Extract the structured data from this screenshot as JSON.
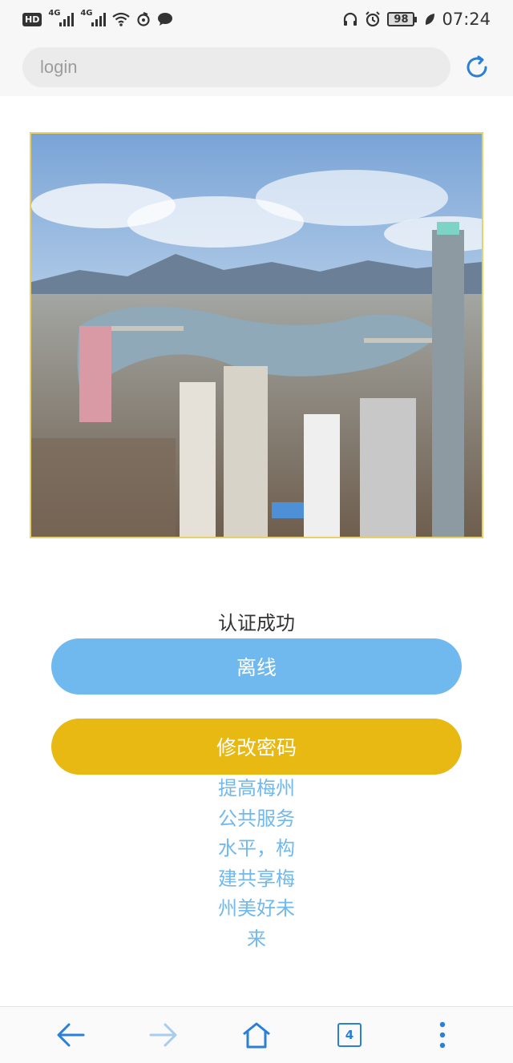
{
  "status_bar": {
    "hd_label": "HD",
    "signal1_label": "4G",
    "signal2_label": "4G",
    "battery": "98",
    "time": "07:24"
  },
  "address_bar": {
    "placeholder": "login"
  },
  "main": {
    "status_text": "认证成功",
    "offline_button": "离线",
    "change_password_button": "修改密码",
    "slogan": "提高梅州公共服务水平，构建共享梅州美好未来"
  },
  "bottom_nav": {
    "tab_count": "4"
  },
  "colors": {
    "accent_blue": "#6fb9ee",
    "accent_yellow": "#e8b912",
    "nav_blue": "#2a7fd6"
  },
  "icons": [
    "back-arrow-icon",
    "forward-arrow-icon",
    "home-icon",
    "tabs-icon",
    "more-vertical-icon",
    "reload-icon",
    "wifi-icon",
    "headphones-icon",
    "alarm-icon",
    "leaf-icon"
  ]
}
